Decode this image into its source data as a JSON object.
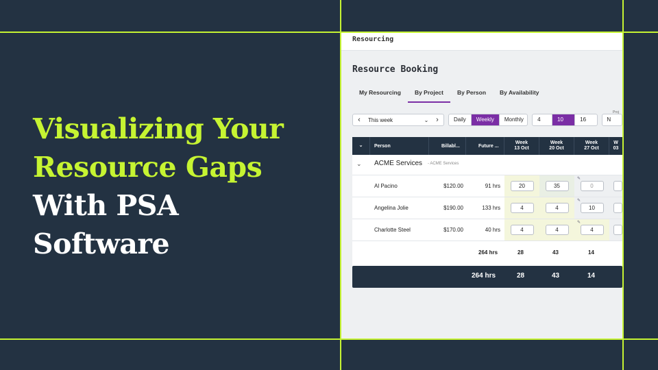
{
  "headline": {
    "highlight": "Visualizing Your Resource Gaps",
    "rest": "With PSA Software"
  },
  "colors": {
    "background": "#233242",
    "accent": "#c6f432",
    "purple": "#7b2ea5"
  },
  "app": {
    "breadcrumb": "Resourcing",
    "page_title": "Resource Booking",
    "tabs": [
      {
        "label": "My Resourcing",
        "active": false
      },
      {
        "label": "By Project",
        "active": true
      },
      {
        "label": "By Person",
        "active": false
      },
      {
        "label": "By Availability",
        "active": false
      }
    ],
    "week_selector": {
      "value": "This week",
      "prev_icon": "chevron-left-icon",
      "next_icon": "chevron-right-icon"
    },
    "period_options": [
      "Daily",
      "Weekly",
      "Monthly"
    ],
    "period_selected": "Weekly",
    "range_options": [
      "4 W",
      "10 W",
      "16 W"
    ],
    "range_selected": "10 W",
    "project_label": "Proj",
    "project_value": "N",
    "table": {
      "headers": {
        "person": "Person",
        "billable": "Billabl...",
        "future": "Future ...",
        "weeks": [
          {
            "line1": "Week",
            "line2": "13 Oct"
          },
          {
            "line1": "Week",
            "line2": "20 Oct"
          },
          {
            "line1": "Week",
            "line2": "27 Oct"
          },
          {
            "line1": "W",
            "line2": "03"
          }
        ]
      },
      "group": {
        "name": "ACME Services",
        "sub": "- ACME Services"
      },
      "rows": [
        {
          "person": "Al Pacino",
          "rate": "$120.00",
          "hours": "91 hrs",
          "weeks": [
            "20",
            "35",
            "0"
          ]
        },
        {
          "person": "Angelina Jolie",
          "rate": "$190.00",
          "hours": "133 hrs",
          "weeks": [
            "4",
            "4",
            "10"
          ]
        },
        {
          "person": "Charlotte Steel",
          "rate": "$170.00",
          "hours": "40 hrs",
          "weeks": [
            "4",
            "4",
            "4"
          ]
        }
      ],
      "subtotal": {
        "hours": "264 hrs",
        "weeks": [
          "28",
          "43",
          "14"
        ]
      },
      "grand_total": {
        "hours": "264 hrs",
        "weeks": [
          "28",
          "43",
          "14"
        ]
      }
    }
  }
}
